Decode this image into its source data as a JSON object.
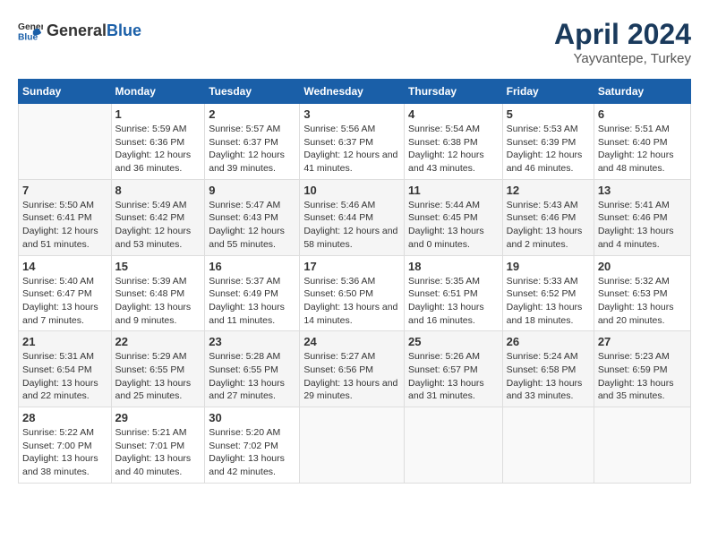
{
  "logo": {
    "general": "General",
    "blue": "Blue"
  },
  "title": "April 2024",
  "subtitle": "Yayvantepe, Turkey",
  "weekdays": [
    "Sunday",
    "Monday",
    "Tuesday",
    "Wednesday",
    "Thursday",
    "Friday",
    "Saturday"
  ],
  "weeks": [
    [
      {
        "day": "",
        "sunrise": "",
        "sunset": "",
        "daylight": ""
      },
      {
        "day": "1",
        "sunrise": "Sunrise: 5:59 AM",
        "sunset": "Sunset: 6:36 PM",
        "daylight": "Daylight: 12 hours and 36 minutes."
      },
      {
        "day": "2",
        "sunrise": "Sunrise: 5:57 AM",
        "sunset": "Sunset: 6:37 PM",
        "daylight": "Daylight: 12 hours and 39 minutes."
      },
      {
        "day": "3",
        "sunrise": "Sunrise: 5:56 AM",
        "sunset": "Sunset: 6:37 PM",
        "daylight": "Daylight: 12 hours and 41 minutes."
      },
      {
        "day": "4",
        "sunrise": "Sunrise: 5:54 AM",
        "sunset": "Sunset: 6:38 PM",
        "daylight": "Daylight: 12 hours and 43 minutes."
      },
      {
        "day": "5",
        "sunrise": "Sunrise: 5:53 AM",
        "sunset": "Sunset: 6:39 PM",
        "daylight": "Daylight: 12 hours and 46 minutes."
      },
      {
        "day": "6",
        "sunrise": "Sunrise: 5:51 AM",
        "sunset": "Sunset: 6:40 PM",
        "daylight": "Daylight: 12 hours and 48 minutes."
      }
    ],
    [
      {
        "day": "7",
        "sunrise": "Sunrise: 5:50 AM",
        "sunset": "Sunset: 6:41 PM",
        "daylight": "Daylight: 12 hours and 51 minutes."
      },
      {
        "day": "8",
        "sunrise": "Sunrise: 5:49 AM",
        "sunset": "Sunset: 6:42 PM",
        "daylight": "Daylight: 12 hours and 53 minutes."
      },
      {
        "day": "9",
        "sunrise": "Sunrise: 5:47 AM",
        "sunset": "Sunset: 6:43 PM",
        "daylight": "Daylight: 12 hours and 55 minutes."
      },
      {
        "day": "10",
        "sunrise": "Sunrise: 5:46 AM",
        "sunset": "Sunset: 6:44 PM",
        "daylight": "Daylight: 12 hours and 58 minutes."
      },
      {
        "day": "11",
        "sunrise": "Sunrise: 5:44 AM",
        "sunset": "Sunset: 6:45 PM",
        "daylight": "Daylight: 13 hours and 0 minutes."
      },
      {
        "day": "12",
        "sunrise": "Sunrise: 5:43 AM",
        "sunset": "Sunset: 6:46 PM",
        "daylight": "Daylight: 13 hours and 2 minutes."
      },
      {
        "day": "13",
        "sunrise": "Sunrise: 5:41 AM",
        "sunset": "Sunset: 6:46 PM",
        "daylight": "Daylight: 13 hours and 4 minutes."
      }
    ],
    [
      {
        "day": "14",
        "sunrise": "Sunrise: 5:40 AM",
        "sunset": "Sunset: 6:47 PM",
        "daylight": "Daylight: 13 hours and 7 minutes."
      },
      {
        "day": "15",
        "sunrise": "Sunrise: 5:39 AM",
        "sunset": "Sunset: 6:48 PM",
        "daylight": "Daylight: 13 hours and 9 minutes."
      },
      {
        "day": "16",
        "sunrise": "Sunrise: 5:37 AM",
        "sunset": "Sunset: 6:49 PM",
        "daylight": "Daylight: 13 hours and 11 minutes."
      },
      {
        "day": "17",
        "sunrise": "Sunrise: 5:36 AM",
        "sunset": "Sunset: 6:50 PM",
        "daylight": "Daylight: 13 hours and 14 minutes."
      },
      {
        "day": "18",
        "sunrise": "Sunrise: 5:35 AM",
        "sunset": "Sunset: 6:51 PM",
        "daylight": "Daylight: 13 hours and 16 minutes."
      },
      {
        "day": "19",
        "sunrise": "Sunrise: 5:33 AM",
        "sunset": "Sunset: 6:52 PM",
        "daylight": "Daylight: 13 hours and 18 minutes."
      },
      {
        "day": "20",
        "sunrise": "Sunrise: 5:32 AM",
        "sunset": "Sunset: 6:53 PM",
        "daylight": "Daylight: 13 hours and 20 minutes."
      }
    ],
    [
      {
        "day": "21",
        "sunrise": "Sunrise: 5:31 AM",
        "sunset": "Sunset: 6:54 PM",
        "daylight": "Daylight: 13 hours and 22 minutes."
      },
      {
        "day": "22",
        "sunrise": "Sunrise: 5:29 AM",
        "sunset": "Sunset: 6:55 PM",
        "daylight": "Daylight: 13 hours and 25 minutes."
      },
      {
        "day": "23",
        "sunrise": "Sunrise: 5:28 AM",
        "sunset": "Sunset: 6:55 PM",
        "daylight": "Daylight: 13 hours and 27 minutes."
      },
      {
        "day": "24",
        "sunrise": "Sunrise: 5:27 AM",
        "sunset": "Sunset: 6:56 PM",
        "daylight": "Daylight: 13 hours and 29 minutes."
      },
      {
        "day": "25",
        "sunrise": "Sunrise: 5:26 AM",
        "sunset": "Sunset: 6:57 PM",
        "daylight": "Daylight: 13 hours and 31 minutes."
      },
      {
        "day": "26",
        "sunrise": "Sunrise: 5:24 AM",
        "sunset": "Sunset: 6:58 PM",
        "daylight": "Daylight: 13 hours and 33 minutes."
      },
      {
        "day": "27",
        "sunrise": "Sunrise: 5:23 AM",
        "sunset": "Sunset: 6:59 PM",
        "daylight": "Daylight: 13 hours and 35 minutes."
      }
    ],
    [
      {
        "day": "28",
        "sunrise": "Sunrise: 5:22 AM",
        "sunset": "Sunset: 7:00 PM",
        "daylight": "Daylight: 13 hours and 38 minutes."
      },
      {
        "day": "29",
        "sunrise": "Sunrise: 5:21 AM",
        "sunset": "Sunset: 7:01 PM",
        "daylight": "Daylight: 13 hours and 40 minutes."
      },
      {
        "day": "30",
        "sunrise": "Sunrise: 5:20 AM",
        "sunset": "Sunset: 7:02 PM",
        "daylight": "Daylight: 13 hours and 42 minutes."
      },
      {
        "day": "",
        "sunrise": "",
        "sunset": "",
        "daylight": ""
      },
      {
        "day": "",
        "sunrise": "",
        "sunset": "",
        "daylight": ""
      },
      {
        "day": "",
        "sunrise": "",
        "sunset": "",
        "daylight": ""
      },
      {
        "day": "",
        "sunrise": "",
        "sunset": "",
        "daylight": ""
      }
    ]
  ]
}
